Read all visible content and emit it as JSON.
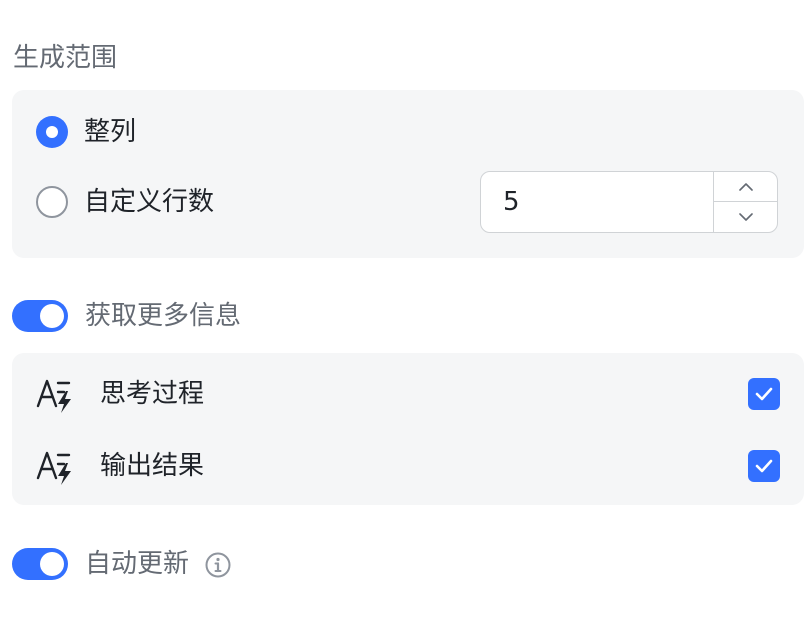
{
  "range_section": {
    "title": "生成范围",
    "options": [
      {
        "label": "整列",
        "selected": true
      },
      {
        "label": "自定义行数",
        "selected": false
      }
    ],
    "row_count": "5"
  },
  "more_info": {
    "label": "获取更多信息",
    "enabled": true,
    "items": [
      {
        "label": "思考过程",
        "checked": true,
        "icon": "ai-text-icon"
      },
      {
        "label": "输出结果",
        "checked": true,
        "icon": "ai-text-icon"
      }
    ]
  },
  "auto_update": {
    "label": "自动更新",
    "enabled": true,
    "icon": "info-icon"
  },
  "colors": {
    "accent": "#3370ff",
    "panel": "#f5f6f7",
    "secondary_text": "#646a73"
  }
}
